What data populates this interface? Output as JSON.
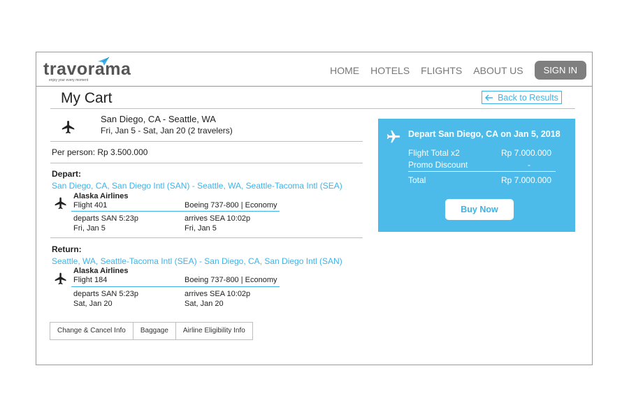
{
  "brand": {
    "logo_text": "travorama",
    "tagline": "enjoy your every moment",
    "accent_color": "#3db3e8"
  },
  "nav": {
    "items": [
      "HOME",
      "HOTELS",
      "FLIGHTS",
      "ABOUT US"
    ],
    "sign_in": "SIGN IN"
  },
  "page": {
    "title": "My Cart",
    "back_label": "Back to Results"
  },
  "trip": {
    "route": "San Diego, CA - Seattle, WA",
    "dates": "Fri, Jan 5 - Sat, Jan 20 (2 travelers)",
    "per_person": "Per person: Rp 3.500.000"
  },
  "depart": {
    "label": "Depart:",
    "route": "San Diego, CA, San Diego Intl (SAN) - Seattle, WA, Seattle-Tacoma Intl (SEA)",
    "airline": "Alaska Airlines",
    "flight": "Flight 401",
    "aircraft": "Boeing 737-800 | Economy",
    "departs": "departs SAN 5:23p",
    "depart_date": "Fri, Jan 5",
    "arrives": "arrives SEA 10:02p",
    "arrive_date": "Fri, Jan 5"
  },
  "return": {
    "label": "Return:",
    "route": "Seattle, WA, Seattle-Tacoma Intl (SEA) - San Diego, CA, San Diego Intl (SAN)",
    "airline": "Alaska Airlines",
    "flight": "Flight 184",
    "aircraft": "Boeing 737-800 | Economy",
    "departs": "departs SAN 5:23p",
    "depart_date": "Sat, Jan 20",
    "arrives": "arrives SEA 10:02p",
    "arrive_date": "Sat, Jan 20"
  },
  "tabs": [
    "Change & Cancel Info",
    "Baggage",
    "Airline Eligibility Info"
  ],
  "summary": {
    "title": "Depart San Diego, CA on Jan 5, 2018",
    "flight_total_label": "Flight Total x2",
    "flight_total_value": "Rp 7.000.000",
    "promo_label": "Promo Discount",
    "promo_value": "-",
    "total_label": "Total",
    "total_value": "Rp 7.000.000",
    "buy_label": "Buy Now",
    "panel_color": "#4cbbe9"
  },
  "icons": {
    "plane": "airplane-icon",
    "back": "arrow-left-icon"
  }
}
